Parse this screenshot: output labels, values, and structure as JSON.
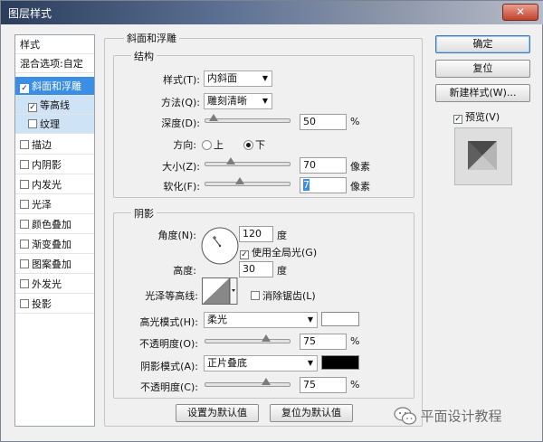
{
  "window": {
    "title": "图层样式",
    "close_icon": "✕"
  },
  "style_list": {
    "header": "样式",
    "blend_options": "混合选项:自定",
    "items": [
      {
        "label": "斜面和浮雕",
        "checked": true
      },
      {
        "label": "等高线",
        "checked": true
      },
      {
        "label": "纹理",
        "checked": false
      },
      {
        "label": "描边",
        "checked": false
      },
      {
        "label": "内阴影",
        "checked": false
      },
      {
        "label": "内发光",
        "checked": false
      },
      {
        "label": "光泽",
        "checked": false
      },
      {
        "label": "颜色叠加",
        "checked": false
      },
      {
        "label": "渐变叠加",
        "checked": false
      },
      {
        "label": "图案叠加",
        "checked": false
      },
      {
        "label": "外发光",
        "checked": false
      },
      {
        "label": "投影",
        "checked": false
      }
    ],
    "check_mark": "✓"
  },
  "bevel": {
    "group_title": "斜面和浮雕",
    "structure": {
      "title": "结构",
      "style_label": "样式(T):",
      "style_value": "内斜面",
      "technique_label": "方法(Q):",
      "technique_value": "雕刻清晰",
      "depth_label": "深度(D):",
      "depth_value": "50",
      "depth_unit": "%",
      "depth_fraction": 0.05,
      "direction_label": "方向:",
      "direction_up": "上",
      "direction_down": "下",
      "direction_selected": "下",
      "size_label": "大小(Z):",
      "size_value": "70",
      "size_unit": "像素",
      "size_fraction": 0.28,
      "soften_label": "软化(F):",
      "soften_value": "7",
      "soften_unit": "像素",
      "soften_fraction": 0.4
    },
    "shading": {
      "title": "阴影",
      "angle_label": "角度(N):",
      "angle_value": "120",
      "angle_unit": "度",
      "global_light_label": "使用全局光(G)",
      "global_light_checked": true,
      "altitude_label": "高度:",
      "altitude_value": "30",
      "altitude_unit": "度",
      "gloss_contour_label": "光泽等高线:",
      "anti_alias_label": "消除锯齿(L)",
      "anti_alias_checked": false,
      "highlight_mode_label": "高光模式(H):",
      "highlight_mode_value": "柔光",
      "highlight_color": "#ffffff",
      "highlight_opacity_label": "不透明度(O):",
      "highlight_opacity_value": "75",
      "highlight_opacity_unit": "%",
      "highlight_opacity_fraction": 0.75,
      "shadow_mode_label": "阴影模式(A):",
      "shadow_mode_value": "正片叠底",
      "shadow_color": "#000000",
      "shadow_opacity_label": "不透明度(C):",
      "shadow_opacity_value": "75",
      "shadow_opacity_unit": "%",
      "shadow_opacity_fraction": 0.75
    },
    "set_default_label": "设置为默认值",
    "reset_default_label": "复位为默认值"
  },
  "right_panel": {
    "ok_label": "确定",
    "reset_label": "复位",
    "new_style_label": "新建样式(W)...",
    "preview_label": "预览(V)",
    "preview_checked": true
  },
  "watermark": {
    "text": "平面设计教程"
  },
  "colors": {
    "selection": "#3a8ee6",
    "sub_selection": "#cfe3f7"
  }
}
